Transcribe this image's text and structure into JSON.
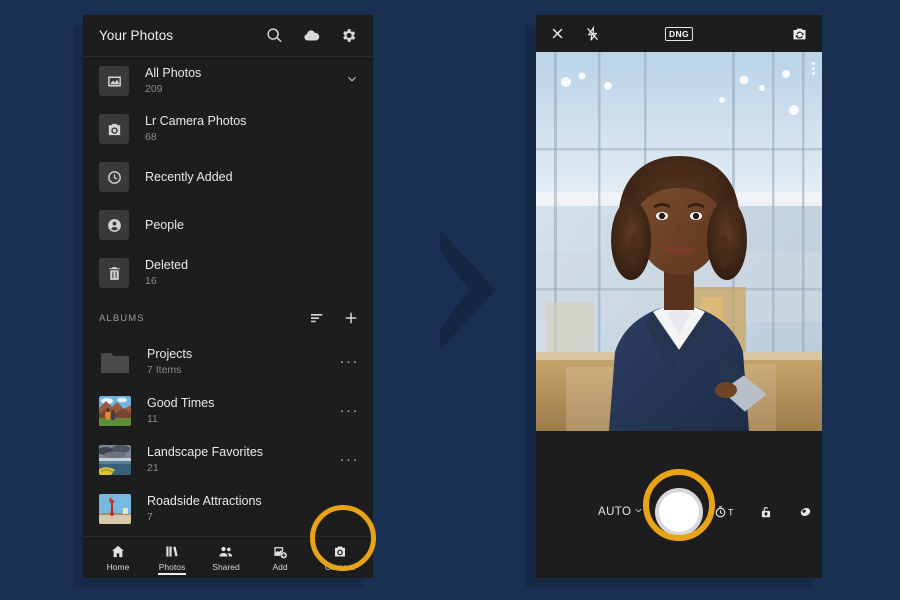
{
  "colors": {
    "background": "#1a3052",
    "panel": "#1d1d1d",
    "highlight_ring": "#E8A317",
    "text_primary": "#e9e9e9",
    "text_secondary": "#8d8d8d"
  },
  "left_panel": {
    "header": {
      "title": "Your Photos",
      "icons": [
        "search-icon",
        "cloud-icon",
        "gear-icon"
      ]
    },
    "nav_items": [
      {
        "label": "All Photos",
        "count": "209",
        "icon": "all-photos-icon",
        "chevron": "chevron-down-icon"
      },
      {
        "label": "Lr Camera Photos",
        "count": "68",
        "icon": "camera-icon"
      },
      {
        "label": "Recently Added",
        "count": "",
        "icon": "clock-icon"
      },
      {
        "label": "People",
        "count": "",
        "icon": "person-icon"
      },
      {
        "label": "Deleted",
        "count": "16",
        "icon": "trash-icon"
      }
    ],
    "albums_section": {
      "title": "ALBUMS",
      "actions": [
        "sort-icon",
        "add-icon"
      ],
      "albums": [
        {
          "label": "Projects",
          "count": "7 Items",
          "thumb": "folder-icon",
          "more": "···"
        },
        {
          "label": "Good Times",
          "count": "11",
          "thumb": "canyon-hikers-thumb",
          "more": "···"
        },
        {
          "label": "Landscape Favorites",
          "count": "21",
          "thumb": "stormy-lake-thumb",
          "more": "···"
        },
        {
          "label": "Roadside Attractions",
          "count": "7",
          "thumb": "red-arrow-sign-thumb",
          "more": "···"
        }
      ]
    },
    "bottom_nav": {
      "items": [
        {
          "label": "Home",
          "icon": "home-icon",
          "active": false
        },
        {
          "label": "Photos",
          "icon": "library-icon",
          "active": true
        },
        {
          "label": "Shared",
          "icon": "people-icon",
          "active": false
        },
        {
          "label": "Add",
          "icon": "add-photo-icon",
          "active": false
        },
        {
          "label": "Camera",
          "icon": "camera-icon",
          "active": false,
          "highlighted": true
        }
      ]
    }
  },
  "right_panel": {
    "top_bar": {
      "close": "close-icon",
      "flash": "flash-off-icon",
      "format_badge": "DNG",
      "flip": "camera-flip-icon"
    },
    "viewfinder": {
      "description": "Portrait of a smiling woman with shoulder-length braided hair wearing a navy blazer over a white shirt, holding a tablet, standing in a bright glass-walled office lobby",
      "level_indicator": "level-dots"
    },
    "controls": {
      "mode_label": "AUTO",
      "mode_chevron": "chevron-down-icon",
      "shutter": "shutter-button",
      "timer_label": "T",
      "icons": [
        "timer-icon",
        "exposure-lock-icon",
        "preset-icon"
      ]
    }
  }
}
